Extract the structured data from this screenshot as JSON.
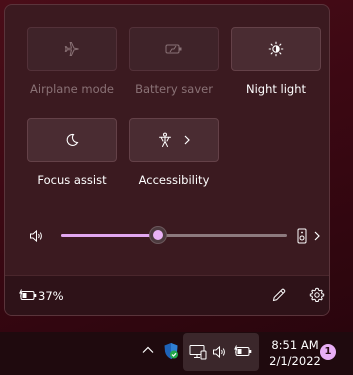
{
  "quick_settings": {
    "tiles": [
      {
        "label": "Airplane mode",
        "icon": "airplane-icon",
        "state": "disabled"
      },
      {
        "label": "Battery saver",
        "icon": "battery-saver-icon",
        "state": "disabled"
      },
      {
        "label": "Night light",
        "icon": "night-light-icon",
        "state": "available"
      },
      {
        "label": "Focus assist",
        "icon": "focus-assist-icon",
        "state": "available"
      },
      {
        "label": "Accessibility",
        "icon": "accessibility-icon",
        "state": "available"
      }
    ],
    "volume": {
      "level": 0.43,
      "icon": "speaker-icon",
      "output_icon": "speaker-device-icon"
    },
    "footer": {
      "battery_percent": "37%",
      "battery_icon": "battery-charging-icon",
      "edit_icon": "pencil-icon",
      "settings_icon": "gear-icon"
    }
  },
  "taskbar": {
    "time": "8:51 AM",
    "date": "2/1/2022",
    "notification_count": "1"
  },
  "colors": {
    "accent": "#e2a7f0",
    "panel_bg": "#3b1a20",
    "footer_bg": "#2e1218",
    "taskbar_bg": "#1f0a0e"
  }
}
